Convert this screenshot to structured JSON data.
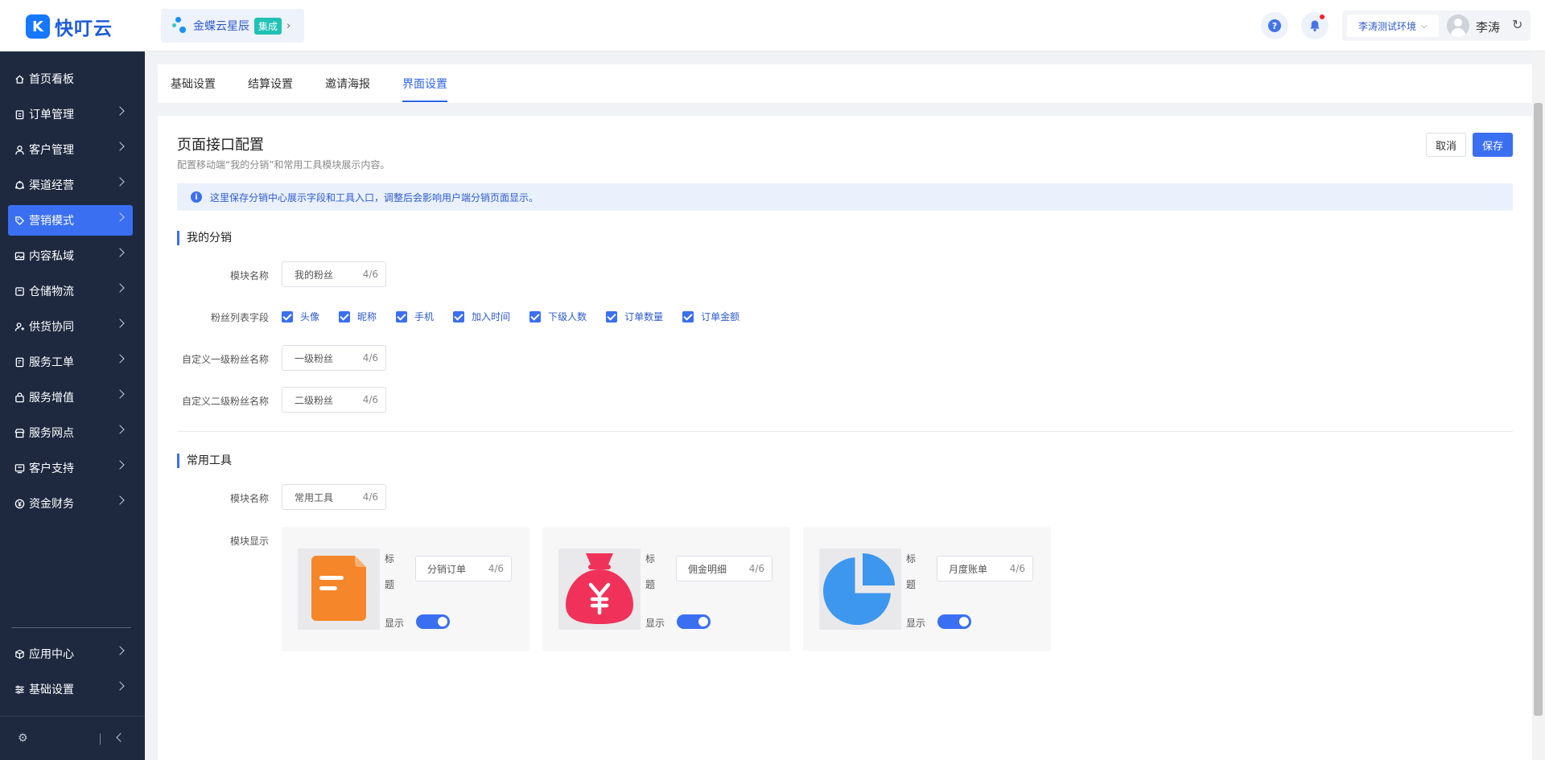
{
  "header": {
    "app_name": "快叮云",
    "org": {
      "name": "金蝶云星辰",
      "badge": "集成"
    },
    "environment": "李涛测试环境",
    "user_name": "李涛"
  },
  "sidebar": {
    "items": [
      {
        "label": "首页看板",
        "icon": "home-icon",
        "active": false,
        "has_arrow": false
      },
      {
        "label": "订单管理",
        "icon": "clipboard-icon",
        "active": false,
        "has_arrow": true
      },
      {
        "label": "客户管理",
        "icon": "user-icon",
        "active": false,
        "has_arrow": true
      },
      {
        "label": "渠道经营",
        "icon": "channel-icon",
        "active": false,
        "has_arrow": true
      },
      {
        "label": "营销模式",
        "icon": "tag-icon",
        "active": true,
        "has_arrow": true
      },
      {
        "label": "内容私域",
        "icon": "image-icon",
        "active": false,
        "has_arrow": true
      },
      {
        "label": "仓储物流",
        "icon": "box-icon",
        "active": false,
        "has_arrow": true
      },
      {
        "label": "供货协同",
        "icon": "supplier-icon",
        "active": false,
        "has_arrow": true
      },
      {
        "label": "服务工单",
        "icon": "ticket-icon",
        "active": false,
        "has_arrow": true
      },
      {
        "label": "服务增值",
        "icon": "bag-icon",
        "active": false,
        "has_arrow": true
      },
      {
        "label": "服务网点",
        "icon": "store-icon",
        "active": false,
        "has_arrow": true
      },
      {
        "label": "客户支持",
        "icon": "support-icon",
        "active": false,
        "has_arrow": true
      },
      {
        "label": "资金财务",
        "icon": "yuan-icon",
        "active": false,
        "has_arrow": true
      }
    ],
    "bottom_items": [
      {
        "label": "应用中心",
        "icon": "cube-icon",
        "has_arrow": true
      },
      {
        "label": "基础设置",
        "icon": "settings-list-icon",
        "has_arrow": true
      }
    ]
  },
  "tabs": [
    {
      "label": "基础设置",
      "active": false
    },
    {
      "label": "结算设置",
      "active": false
    },
    {
      "label": "邀请海报",
      "active": false
    },
    {
      "label": "界面设置",
      "active": true
    }
  ],
  "page": {
    "title": "页面接口配置",
    "description": "配置移动端“我的分销”和常用工具模块展示内容。",
    "cancel_label": "取消",
    "save_label": "保存",
    "info": "这里保存分销中心展示字段和工具入口，调整后会影响用户端分销页面显示。"
  },
  "my_distribution": {
    "section_title": "我的分销",
    "module_name_label": "模块名称",
    "module_name_value": "我的粉丝",
    "module_name_count": "4/6",
    "fields_label": "粉丝列表字段",
    "fields": [
      {
        "label": "头像",
        "checked": true
      },
      {
        "label": "昵称",
        "checked": true
      },
      {
        "label": "手机",
        "checked": true
      },
      {
        "label": "加入时间",
        "checked": true
      },
      {
        "label": "下级人数",
        "checked": true
      },
      {
        "label": "订单数量",
        "checked": true
      },
      {
        "label": "订单金额",
        "checked": true
      }
    ],
    "level1_label": "自定义一级粉丝名称",
    "level1_value": "一级粉丝",
    "level1_count": "4/6",
    "level2_label": "自定义二级粉丝名称",
    "level2_value": "二级粉丝",
    "level2_count": "4/6"
  },
  "common_tools": {
    "section_title": "常用工具",
    "module_name_label": "模块名称",
    "module_name_value": "常用工具",
    "module_name_count": "4/6",
    "display_label": "模块显示",
    "title_label": "标题",
    "show_label": "显示",
    "tools": [
      {
        "title": "分销订单",
        "count": "4/6",
        "icon": "document-icon",
        "color": "#f5862a",
        "shown": true
      },
      {
        "title": "佣金明细",
        "count": "4/6",
        "icon": "money-bag-icon",
        "color": "#f0325a",
        "shown": true
      },
      {
        "title": "月度账单",
        "count": "4/6",
        "icon": "pie-chart-icon",
        "color": "#3d97ef",
        "shown": true
      }
    ]
  },
  "colors": {
    "primary": "#3a6ff2",
    "sidebar_bg": "#1e2940",
    "active_tab": "#2d63e8"
  }
}
